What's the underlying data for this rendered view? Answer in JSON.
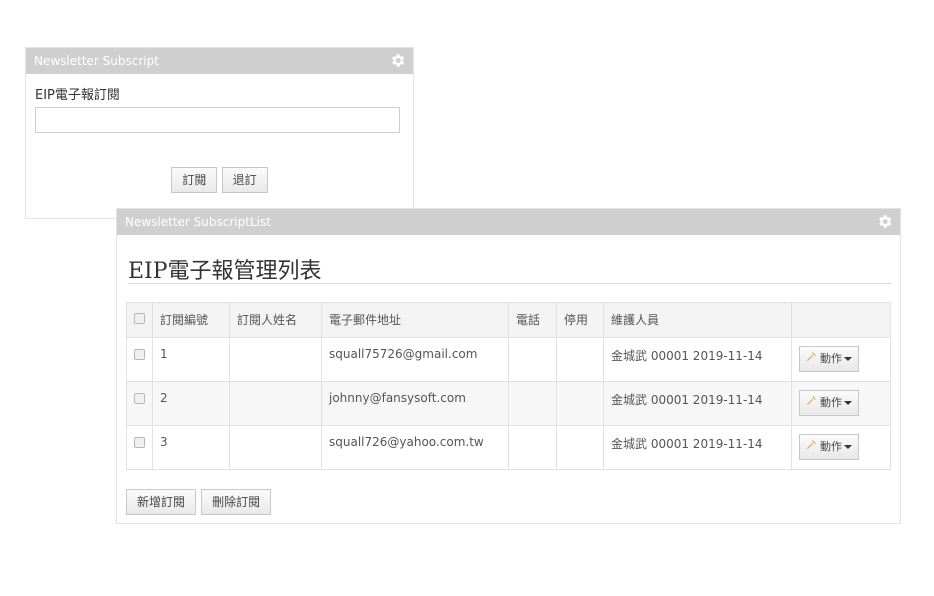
{
  "subscribe_panel": {
    "title": "Newsletter Subscript",
    "field_label": "EIP電子報訂閱",
    "input_value": "",
    "subscribe_label": "訂閱",
    "unsubscribe_label": "退訂"
  },
  "list_panel": {
    "title": "Newsletter SubscriptList",
    "page_title": "EIP電子報管理列表",
    "columns": [
      "訂閱編號",
      "訂閱人姓名",
      "電子郵件地址",
      "電話",
      "停用",
      "維護人員"
    ],
    "rows": [
      {
        "id": "1",
        "name": "",
        "email": "squall75726@gmail.com",
        "phone": "",
        "disabled": "",
        "maintainer": "金城武 00001 2019-11-14",
        "action_label": "動作"
      },
      {
        "id": "2",
        "name": "",
        "email": "johnny@fansysoft.com",
        "phone": "",
        "disabled": "",
        "maintainer": "金城武 00001 2019-11-14",
        "action_label": "動作"
      },
      {
        "id": "3",
        "name": "",
        "email": "squall726@yahoo.com.tw",
        "phone": "",
        "disabled": "",
        "maintainer": "金城武 00001 2019-11-14",
        "action_label": "動作"
      }
    ],
    "add_label": "新增訂閱",
    "delete_label": "刪除訂閱"
  },
  "icons": {
    "settings": "gear-icon",
    "action": "wrench-icon",
    "dropdown": "caret-down-icon"
  },
  "colors": {
    "header_bg": "#cfcfcf",
    "header_text": "#ffffff",
    "table_header_bg": "#f3f3f3",
    "accent_wrench": "#e8a32a"
  }
}
